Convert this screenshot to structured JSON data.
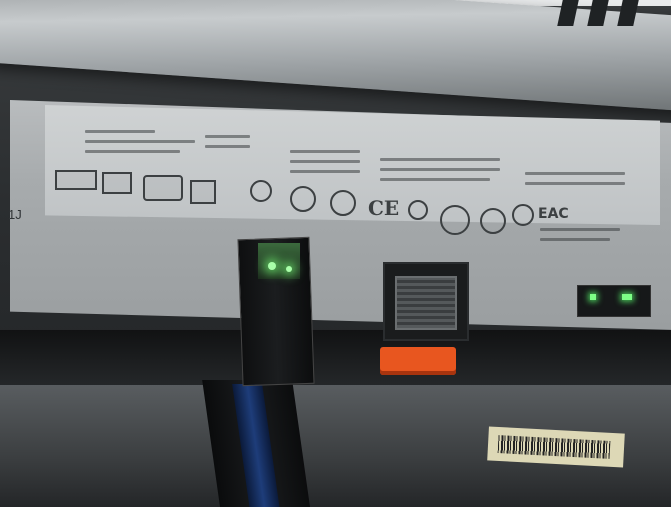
{
  "photo": {
    "label_side_text": "1J",
    "label_ce_mark": "CE",
    "label_eac_mark": "EAC",
    "colors": {
      "led_green": "#7dff86",
      "tab_orange": "#e8561f",
      "metal": "#b9bcbe"
    }
  }
}
